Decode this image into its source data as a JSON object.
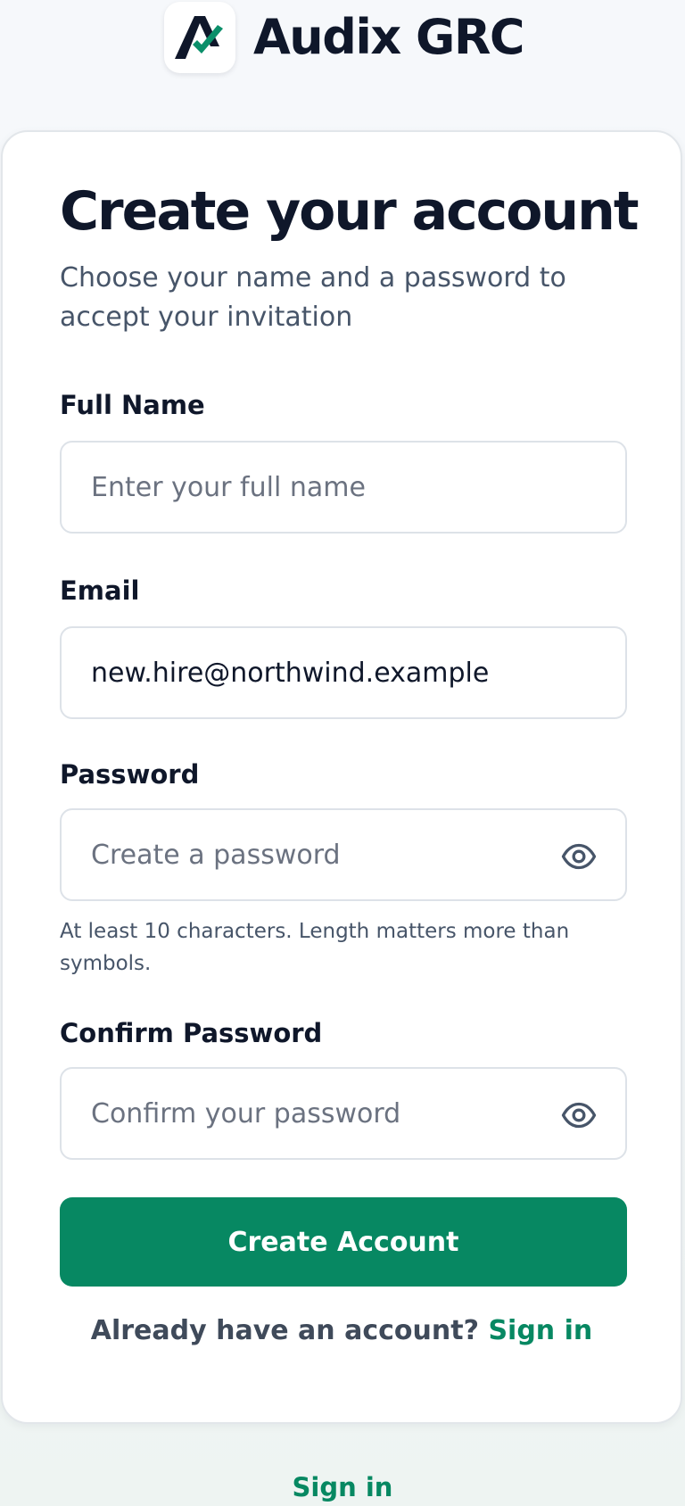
{
  "brand": {
    "name": "Audix GRC",
    "logo_icon": "audix-logo-icon",
    "logo_colors": {
      "letter": "#0f172a",
      "check": "#0b8f6a"
    }
  },
  "card": {
    "title": "Create your account",
    "subtitle": "Choose your name and a password to accept your invitation"
  },
  "form": {
    "full_name": {
      "label": "Full Name",
      "value": "",
      "placeholder": "Enter your full name"
    },
    "email": {
      "label": "Email",
      "value": "new.hire@northwind.example",
      "placeholder": ""
    },
    "password": {
      "label": "Password",
      "value": "",
      "placeholder": "Create a password",
      "toggle_icon": "eye-icon",
      "hint": "At least 10 characters. Length matters more than symbols."
    },
    "confirm_password": {
      "label": "Confirm Password",
      "value": "",
      "placeholder": "Confirm your password",
      "toggle_icon": "eye-icon"
    },
    "submit_label": "Create Account"
  },
  "signin_prompt": {
    "text": "Already have an account?",
    "link_label": "Sign in"
  },
  "footer": {
    "link_label": "Sign in"
  },
  "colors": {
    "accent": "#078862",
    "heading": "#0f172a",
    "muted": "#475569",
    "input_border": "#dde2e8"
  }
}
